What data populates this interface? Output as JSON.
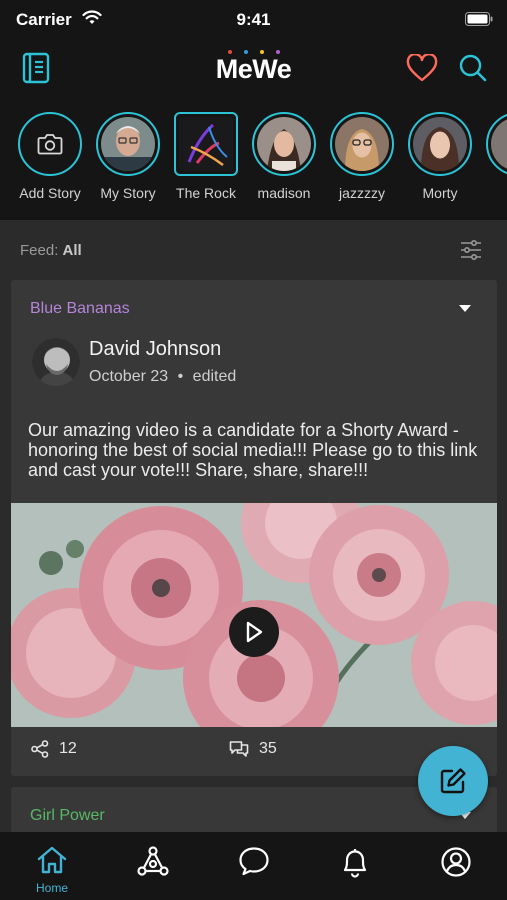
{
  "status_bar": {
    "carrier": "Carrier",
    "time": "9:41"
  },
  "header": {
    "logo": "MeWe",
    "logo_dot_colors": [
      "#e04b3f",
      "#2f9be0",
      "#f2c42c",
      "#b25fd6"
    ],
    "icons": [
      "notebook-icon",
      "heart-icon",
      "search-icon"
    ],
    "accent": "#2cc3d6",
    "heart_color": "#ff6b5b"
  },
  "stories": [
    {
      "label": "Add Story",
      "icon": "camera-icon"
    },
    {
      "label": "My Story"
    },
    {
      "label": "The Rock"
    },
    {
      "label": "madison"
    },
    {
      "label": "jazzzzy"
    },
    {
      "label": "Morty"
    }
  ],
  "feed": {
    "label": "Feed:",
    "value": "All"
  },
  "post": {
    "group": "Blue Bananas",
    "group_color": "#b485d9",
    "author": "David Johnson",
    "date": "October 23",
    "separator": "•",
    "edited": "edited",
    "text": "Our amazing video is a candidate for a Shorty Award - honoring the best of social media!!! Please go to this link and cast your vote!!! Share, share, share!!!",
    "shares": "12",
    "comments": "35"
  },
  "next_post": {
    "group": "Girl Power",
    "group_color": "#58b866"
  },
  "tab_bar": {
    "active_color": "#43b3d4",
    "tabs": [
      {
        "label": "Home",
        "icon": "home-icon"
      },
      {
        "icon": "network-icon"
      },
      {
        "icon": "chat-icon"
      },
      {
        "icon": "bell-icon"
      },
      {
        "icon": "profile-icon"
      }
    ]
  }
}
